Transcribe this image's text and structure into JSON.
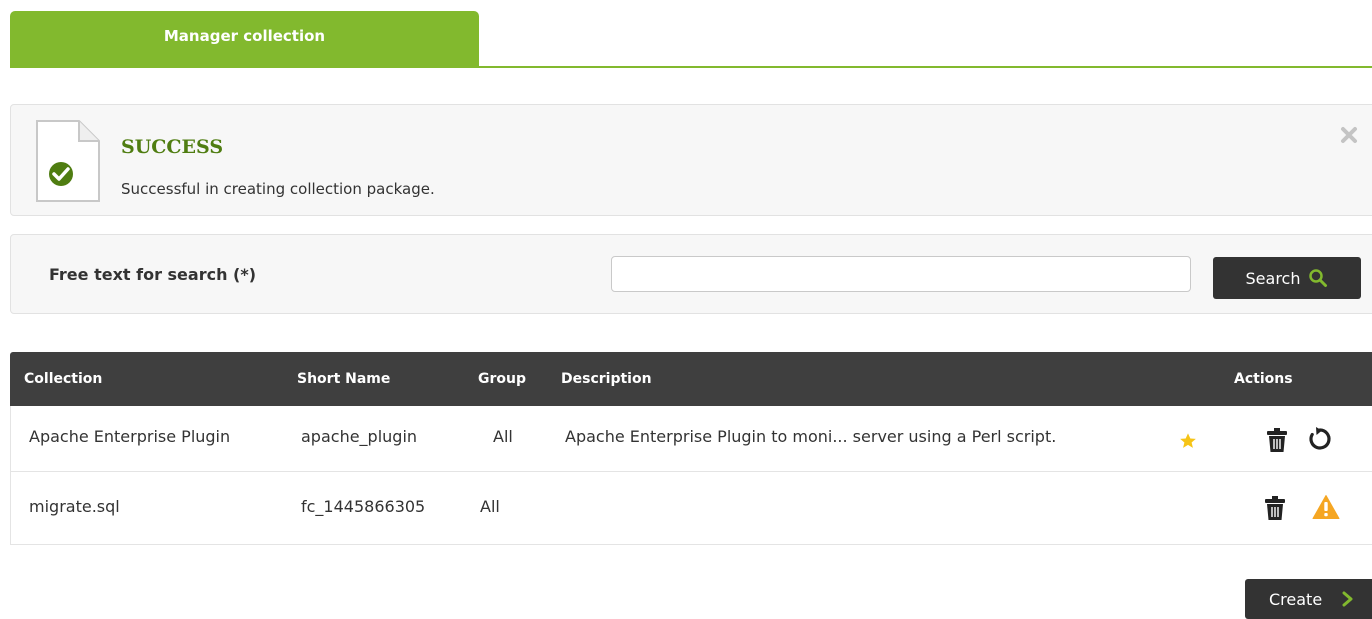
{
  "tabs": {
    "active_label": "Manager collection"
  },
  "alert": {
    "title": "SUCCESS",
    "message": "Successful in creating collection package."
  },
  "search": {
    "label": "Free text for search (*)",
    "input_value": "",
    "button_label": "Search"
  },
  "table": {
    "headers": {
      "collection": "Collection",
      "short_name": "Short Name",
      "group": "Group",
      "description": "Description",
      "actions": "Actions"
    },
    "rows": [
      {
        "collection": "Apache Enterprise Plugin",
        "short_name": "apache_plugin",
        "group": "All",
        "description": "Apache Enterprise Plugin to moni... server using a Perl script.",
        "actions": [
          "trash-icon",
          "refresh-icon"
        ]
      },
      {
        "collection": "migrate.sql",
        "short_name": "fc_1445866305",
        "group": "All",
        "description": "",
        "actions": [
          "trash-icon",
          "warning-icon"
        ]
      }
    ]
  },
  "footer": {
    "create_label": "Create"
  },
  "colors": {
    "accent_green": "#82b92e",
    "title_green": "#4f7d11",
    "dark": "#333333",
    "warning": "#f5a623",
    "star": "#f6c417"
  }
}
